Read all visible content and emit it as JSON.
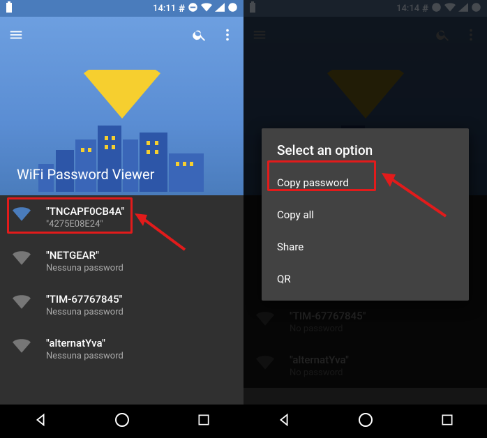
{
  "left": {
    "status_time": "14:11",
    "app_title": "WiFi Password Viewer",
    "networks": [
      {
        "ssid": "\"TNCAPF0CB4A\"",
        "pw": "\"4275E08E24\"",
        "active": true
      },
      {
        "ssid": "\"NETGEAR\"",
        "pw": "Nessuna password",
        "active": false
      },
      {
        "ssid": "\"TIM-67767845\"",
        "pw": "Nessuna password",
        "active": false
      },
      {
        "ssid": "\"alternatYva\"",
        "pw": "Nessuna password",
        "active": false
      }
    ]
  },
  "right": {
    "status_time": "14:14",
    "dialog_title": "Select an option",
    "options": [
      "Copy password",
      "Copy all",
      "Share",
      "QR"
    ],
    "bg_networks": [
      {
        "ssid": "\"TIM-67767845\"",
        "pw": "No password"
      },
      {
        "ssid": "\"alternatYva\"",
        "pw": "No password"
      }
    ]
  },
  "icons": {
    "menu": "menu-icon",
    "search": "search-icon",
    "more": "more-vert-icon",
    "hash": "hash-icon",
    "dnd": "dnd-icon",
    "wifistatus": "wifi-status-icon",
    "signal": "signal-icon",
    "batt": "battery-icon"
  }
}
